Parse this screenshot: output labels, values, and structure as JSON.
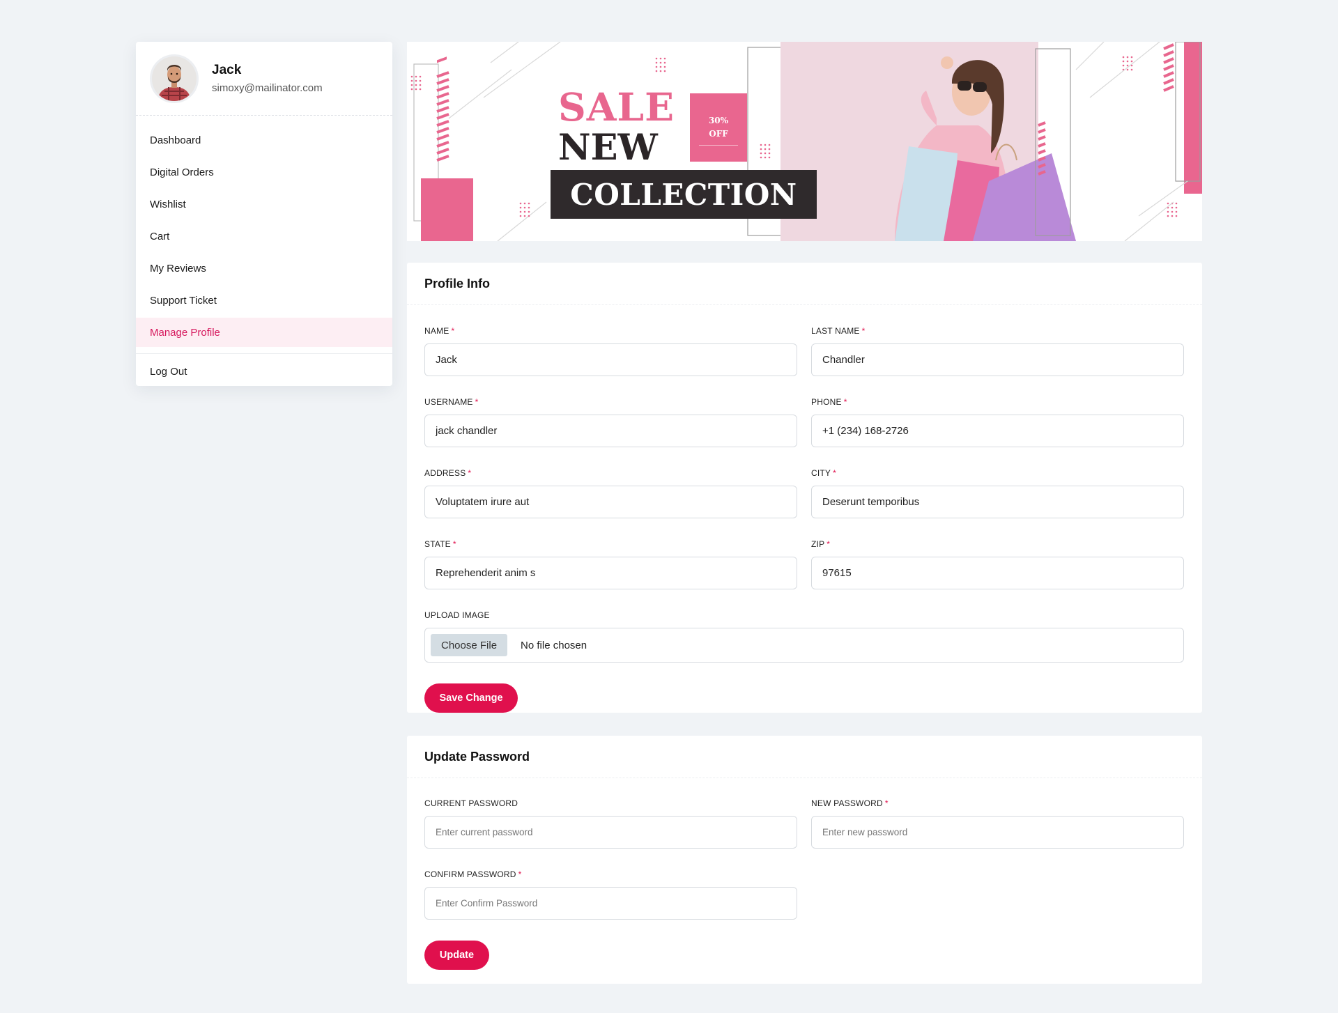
{
  "user": {
    "name": "Jack",
    "email": "simoxy@mailinator.com"
  },
  "sidebar": {
    "items": [
      {
        "label": "Dashboard"
      },
      {
        "label": "Digital Orders"
      },
      {
        "label": "Wishlist"
      },
      {
        "label": "Cart"
      },
      {
        "label": "My Reviews"
      },
      {
        "label": "Support Ticket"
      },
      {
        "label": "Manage Profile",
        "active": true
      },
      {
        "label": "Log Out"
      }
    ]
  },
  "banner": {
    "sale": "SALE",
    "new": "NEW",
    "collection": "COLLECTION",
    "discount_pct": "30%",
    "discount_off": "OFF"
  },
  "profile_info": {
    "title": "Profile Info",
    "fields": {
      "name": {
        "label": "NAME",
        "value": "Jack"
      },
      "last_name": {
        "label": "LAST NAME",
        "value": "Chandler"
      },
      "username": {
        "label": "USERNAME",
        "value": "jack chandler"
      },
      "phone": {
        "label": "PHONE",
        "value": "+1 (234) 168-2726"
      },
      "address": {
        "label": "ADDRESS",
        "value": "Voluptatem irure aut"
      },
      "city": {
        "label": "CITY",
        "value": "Deserunt temporibus"
      },
      "state": {
        "label": "STATE",
        "value": "Reprehenderit anim s"
      },
      "zip": {
        "label": "ZIP",
        "value": "97615"
      },
      "upload": {
        "label": "UPLOAD IMAGE",
        "button": "Choose File",
        "status": "No file chosen"
      }
    },
    "required_mark": "*",
    "save_label": "Save Change"
  },
  "update_password": {
    "title": "Update Password",
    "fields": {
      "current": {
        "label": "CURRENT PASSWORD",
        "placeholder": "Enter current password"
      },
      "new": {
        "label": "NEW PASSWORD",
        "placeholder": "Enter new password"
      },
      "confirm": {
        "label": "CONFIRM PASSWORD",
        "placeholder": "Enter Confirm Password"
      }
    },
    "update_label": "Update"
  },
  "colors": {
    "accent": "#e0104d",
    "active_nav_text": "#d6175c",
    "active_nav_bg": "#fdeef3",
    "banner_pink": "#e9668f",
    "banner_dark": "#2f2a2c",
    "page_bg": "#f0f3f6"
  }
}
